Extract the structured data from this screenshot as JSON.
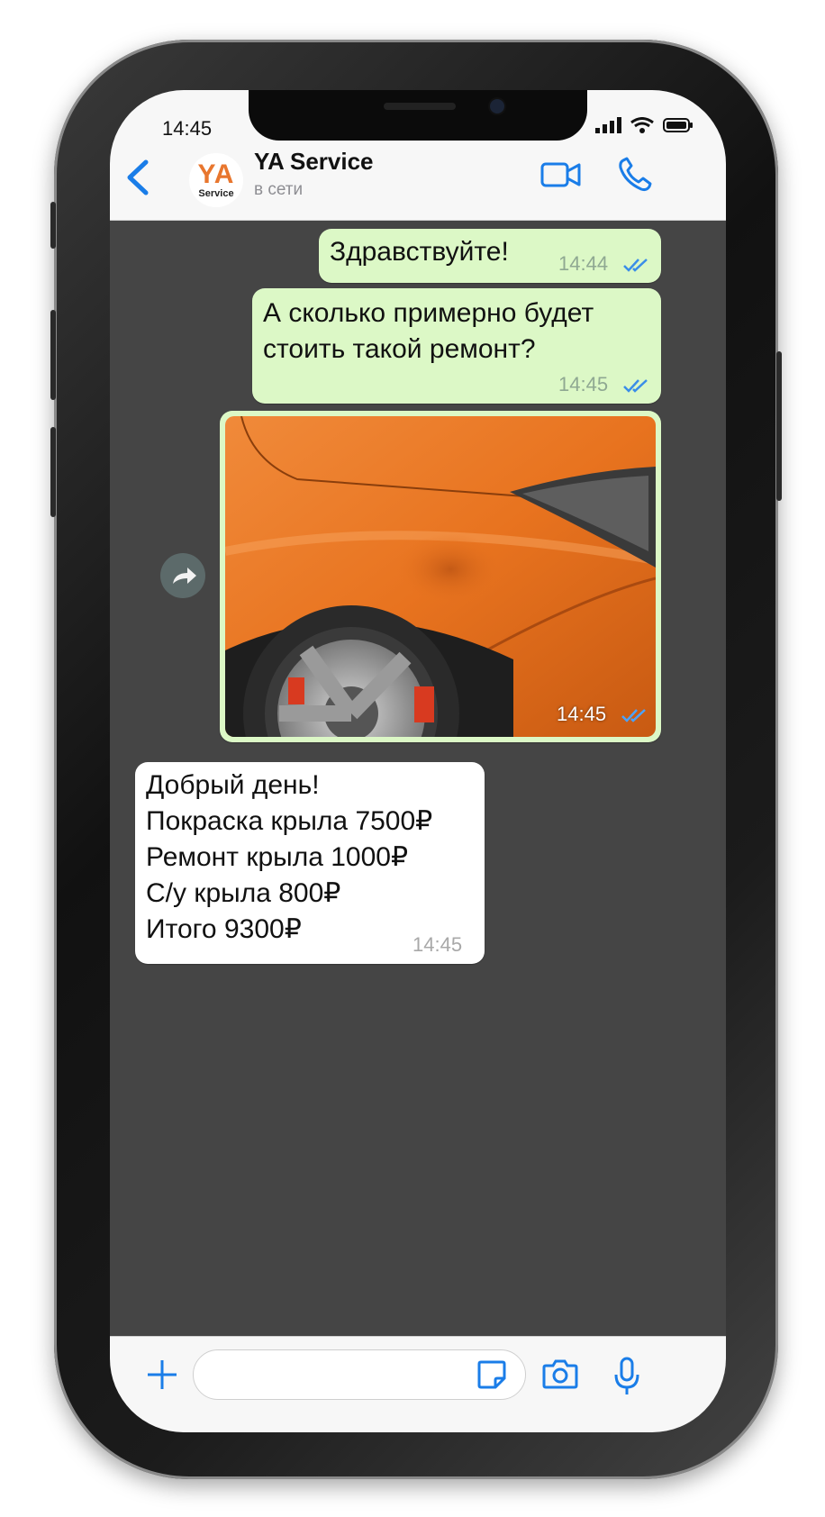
{
  "status_bar": {
    "time": "14:45"
  },
  "header": {
    "avatar": {
      "logo_text": "YA",
      "logo_subtext": "Service",
      "accent": "#e8762e"
    },
    "contact_name": "YA Service",
    "contact_status": "в сети",
    "icons": [
      "back-chevron-icon",
      "video-call-icon",
      "phone-call-icon"
    ]
  },
  "messages": [
    {
      "direction": "out",
      "text": "Здравствуйте!",
      "time": "14:44",
      "status": "read"
    },
    {
      "direction": "out",
      "text": "А сколько примерно будет\nстоить такой ремонт?",
      "time": "14:45",
      "status": "read"
    },
    {
      "direction": "out",
      "type": "photo",
      "photo_subject": "orange car fender with dent",
      "time": "14:45",
      "status": "read"
    },
    {
      "direction": "in",
      "text": "Добрый день!\nПокраска крыла 7500₽\nРемонт крыла 1000₽\nС/у крыла 800₽\nИтого 9300₽",
      "time": "14:45"
    }
  ],
  "composer": {
    "value": "",
    "icons": [
      "plus-icon",
      "sticker-icon",
      "camera-icon",
      "microphone-icon"
    ]
  },
  "colors": {
    "accent_blue": "#1a7de8",
    "outgoing_bubble": "#dcf8c6",
    "incoming_bubble": "#ffffff",
    "chat_background": "#454545"
  }
}
